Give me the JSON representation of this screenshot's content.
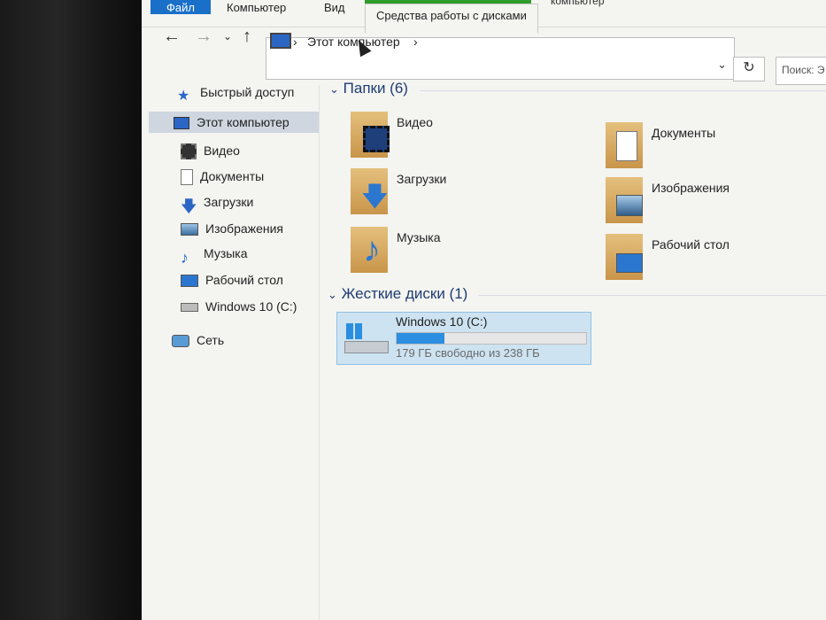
{
  "ribbon": {
    "tab_file": "Файл",
    "tab_computer": "Компьютер",
    "tab_view": "Вид",
    "tab_disk_tools": "Средства работы с дисками",
    "window_title_fragment": "компьютер"
  },
  "address_bar": {
    "breadcrumb": "Этот компьютер",
    "separator": "›",
    "search_placeholder": "Поиск: Э"
  },
  "nav_pane": {
    "quick_access": "Быстрый доступ",
    "this_pc": "Этот компьютер",
    "items": [
      "Видео",
      "Документы",
      "Загрузки",
      "Изображения",
      "Музыка",
      "Рабочий стол",
      "Windows 10 (C:)"
    ],
    "network": "Сеть"
  },
  "folders_group": {
    "header": "Папки (6)",
    "items": [
      "Видео",
      "Документы",
      "Загрузки",
      "Изображения",
      "Музыка",
      "Рабочий стол"
    ]
  },
  "drives_group": {
    "header": "Жесткие диски (1)",
    "drive_name": "Windows 10 (C:)",
    "free_text": "179 ГБ свободно из 238 ГБ",
    "used_fraction": 0.25
  },
  "colors": {
    "accent": "#1a6fc9",
    "disk_tools_tab": "#2e9d2a",
    "selection": "#cde3f1",
    "progress": "#2b8ee0"
  }
}
